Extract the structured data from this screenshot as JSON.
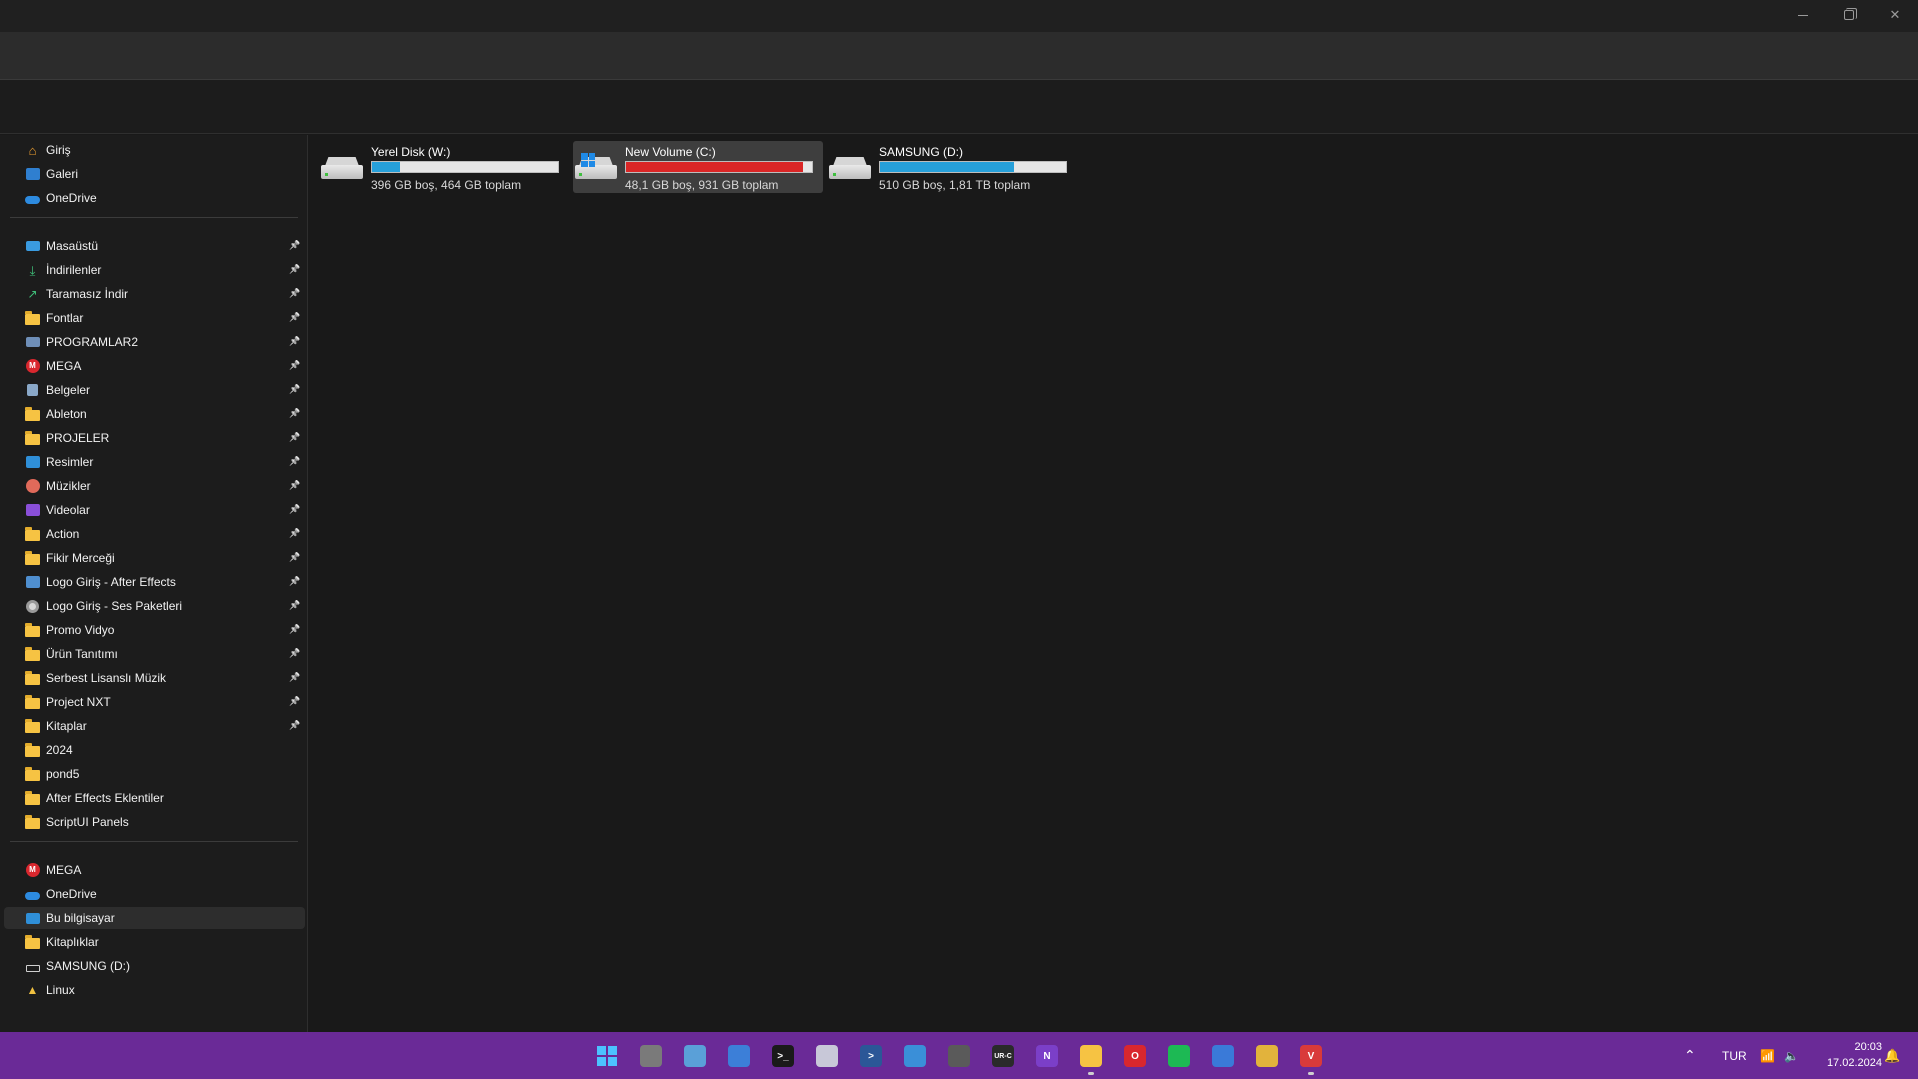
{
  "sidebar": {
    "top": [
      {
        "label": "Giriş",
        "icon": "home-icon"
      },
      {
        "label": "Galeri",
        "icon": "gallery-icon"
      },
      {
        "label": "OneDrive",
        "icon": "onedrive-icon"
      }
    ],
    "quick_access": [
      {
        "label": "Masaüstü",
        "icon": "desktop-icon"
      },
      {
        "label": "İndirilenler",
        "icon": "download-icon"
      },
      {
        "label": "Taramasız İndir",
        "icon": "share-icon"
      },
      {
        "label": "Fontlar",
        "icon": "folder-icon"
      },
      {
        "label": "PROGRAMLAR2",
        "icon": "drive-folder-icon"
      },
      {
        "label": "MEGA",
        "icon": "mega-icon"
      },
      {
        "label": "Belgeler",
        "icon": "documents-icon"
      },
      {
        "label": "Ableton",
        "icon": "folder-icon"
      },
      {
        "label": "PROJELER",
        "icon": "folder-icon"
      },
      {
        "label": "Resimler",
        "icon": "pictures-icon"
      },
      {
        "label": "Müzikler",
        "icon": "music-icon"
      },
      {
        "label": "Videolar",
        "icon": "videos-icon"
      },
      {
        "label": "Action",
        "icon": "folder-icon"
      },
      {
        "label": "Fikir Merceği",
        "icon": "folder-icon"
      },
      {
        "label": "Logo Giriş - After Effects",
        "icon": "grid-folder-icon"
      },
      {
        "label": "Logo Giriş -  Ses Paketleri",
        "icon": "disc-icon"
      },
      {
        "label": "Promo Vidyo",
        "icon": "folder-icon"
      },
      {
        "label": "Ürün Tanıtımı",
        "icon": "folder-icon"
      },
      {
        "label": "Serbest Lisanslı Müzik",
        "icon": "folder-icon"
      },
      {
        "label": "Project NXT",
        "icon": "folder-icon"
      },
      {
        "label": "Kitaplar",
        "icon": "folder-icon"
      },
      {
        "label": "2024",
        "icon": "folder-icon"
      },
      {
        "label": "pond5",
        "icon": "folder-icon"
      },
      {
        "label": "After Effects Eklentiler",
        "icon": "folder-icon"
      },
      {
        "label": "ScriptUI Panels",
        "icon": "folder-icon"
      }
    ],
    "bottom": [
      {
        "label": "MEGA",
        "icon": "mega-icon"
      },
      {
        "label": "OneDrive",
        "icon": "onedrive-icon"
      },
      {
        "label": "Bu bilgisayar",
        "icon": "this-pc-icon",
        "selected": true
      },
      {
        "label": "Kitaplıklar",
        "icon": "folder-icon"
      },
      {
        "label": "SAMSUNG (D:)",
        "icon": "drive-icon"
      },
      {
        "label": "Linux",
        "icon": "linux-icon"
      }
    ]
  },
  "drives": [
    {
      "name": "Yerel Disk (W:)",
      "info": "396 GB boş, 464 GB toplam",
      "used_fraction": 0.15,
      "bar_color": "#26a0da",
      "selected": false,
      "system": false
    },
    {
      "name": "New Volume (C:)",
      "info": "48,1 GB boş, 931 GB toplam",
      "used_fraction": 0.95,
      "bar_color": "#da2626",
      "selected": true,
      "system": true
    },
    {
      "name": "SAMSUNG (D:)",
      "info": "510 GB boş, 1,81 TB toplam",
      "used_fraction": 0.72,
      "bar_color": "#26a0da",
      "selected": false,
      "system": false
    }
  ],
  "taskbar": {
    "apps": [
      {
        "name": "start-button",
        "color": "#1f8ae6",
        "glyph": "",
        "active": false
      },
      {
        "name": "task-view-app",
        "color": "#7a7a7a",
        "glyph": "",
        "active": false
      },
      {
        "name": "resource-monitor-app",
        "color": "#5aa0d8",
        "glyph": "",
        "active": false
      },
      {
        "name": "microsoft-store-app",
        "color": "#3c7fd8",
        "glyph": "",
        "active": false
      },
      {
        "name": "terminal-app",
        "color": "#1a1a1a",
        "glyph": ">_",
        "active": false
      },
      {
        "name": "snipping-tool-app",
        "color": "#c8c8d8",
        "glyph": "",
        "active": false
      },
      {
        "name": "powershell-app",
        "color": "#2b5797",
        "glyph": ">",
        "active": false
      },
      {
        "name": "paint-app",
        "color": "#3a8fd8",
        "glyph": "",
        "active": false
      },
      {
        "name": "lock-app",
        "color": "#5a5a5a",
        "glyph": "",
        "active": false
      },
      {
        "name": "urc-app",
        "color": "#2a2a2a",
        "glyph": "UR-C",
        "active": false
      },
      {
        "name": "onenote-app",
        "color": "#7b3fc8",
        "glyph": "N",
        "active": false
      },
      {
        "name": "file-explorer-app",
        "color": "#f6c343",
        "glyph": "",
        "active": true
      },
      {
        "name": "opera-app",
        "color": "#d9272e",
        "glyph": "O",
        "active": false
      },
      {
        "name": "spotify-app",
        "color": "#1db954",
        "glyph": "",
        "active": false
      },
      {
        "name": "chromium-app",
        "color": "#3a7ad8",
        "glyph": "",
        "active": false
      },
      {
        "name": "chrome-app",
        "color": "#e2b33c",
        "glyph": "",
        "active": false
      },
      {
        "name": "vivaldi-app",
        "color": "#d93a3a",
        "glyph": "V",
        "active": true
      }
    ],
    "language": "TUR",
    "time": "20:03",
    "date": "17.02.2024"
  }
}
